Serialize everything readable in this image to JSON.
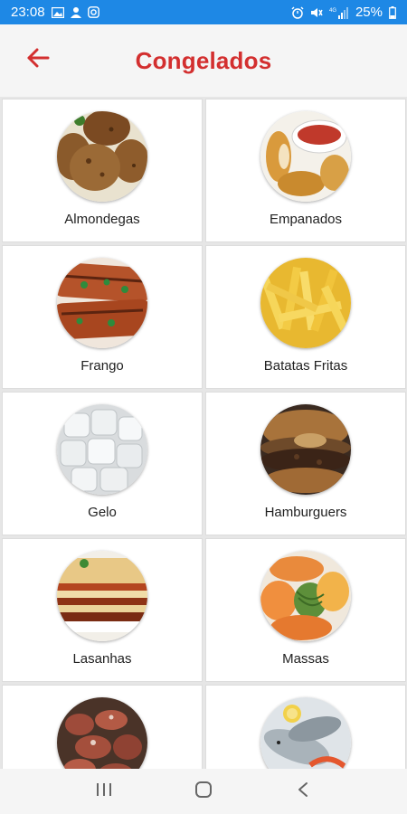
{
  "status_bar": {
    "time": "23:08",
    "battery": "25%",
    "network": "4G",
    "left_icons": [
      "image-icon",
      "account-icon",
      "instagram-icon"
    ],
    "right_icons": [
      "alarm-icon",
      "mute-icon",
      "signal-icon",
      "battery-icon"
    ]
  },
  "header": {
    "title": "Congelados",
    "back_icon": "arrow-left-icon",
    "colors": {
      "title": "#d32f2f",
      "background": "#f5f5f5"
    }
  },
  "categories": [
    {
      "label": "Almondegas",
      "image": "meatballs-photo"
    },
    {
      "label": "Empanados",
      "image": "breaded-chicken-photo"
    },
    {
      "label": "Frango",
      "image": "grilled-chicken-photo"
    },
    {
      "label": "Batatas Fritas",
      "image": "french-fries-photo"
    },
    {
      "label": "Gelo",
      "image": "ice-cubes-photo"
    },
    {
      "label": "Hamburguers",
      "image": "hamburger-photo"
    },
    {
      "label": "Lasanhas",
      "image": "lasagna-photo"
    },
    {
      "label": "Massas",
      "image": "pasta-photo"
    },
    {
      "label": "",
      "image": "meat-cuts-photo"
    },
    {
      "label": "",
      "image": "seafood-photo"
    }
  ],
  "nav_bar": {
    "buttons": [
      "recent-apps-icon",
      "home-icon",
      "back-icon"
    ]
  }
}
